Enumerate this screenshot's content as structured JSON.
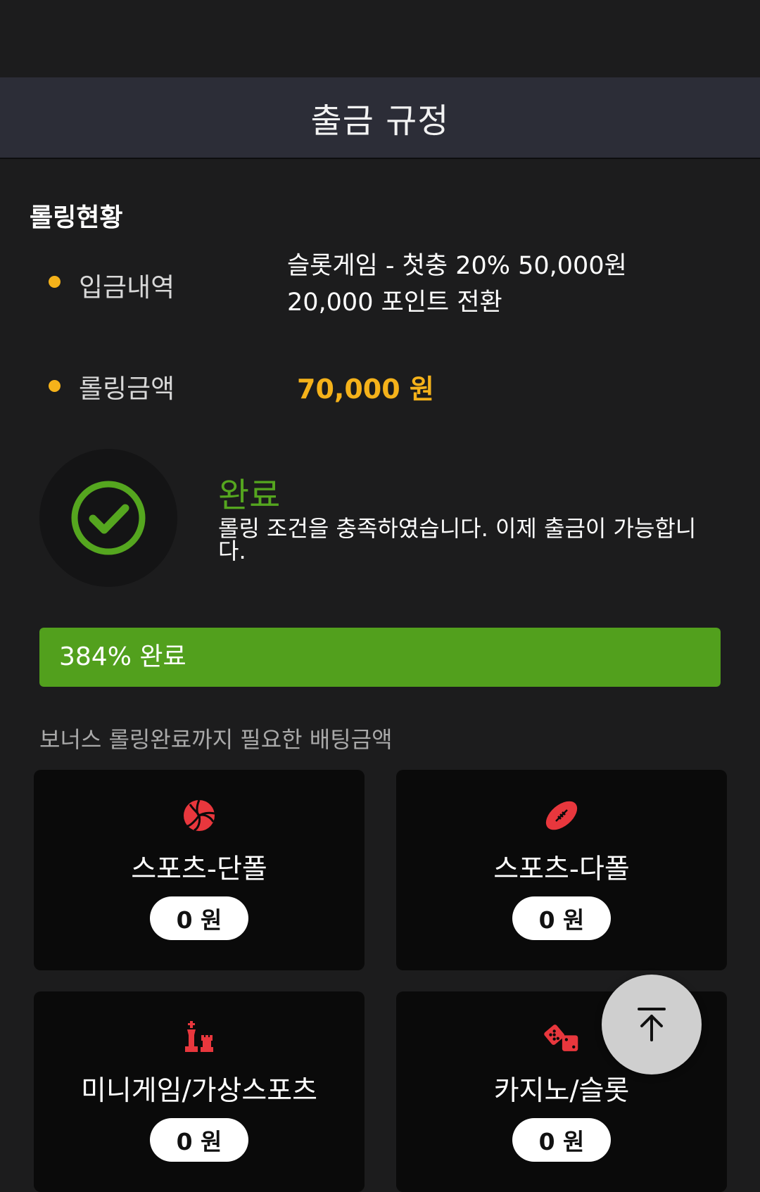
{
  "header": {
    "title": "출금 규정"
  },
  "rolling_status": {
    "section_title": "롤링현황",
    "deposit": {
      "label": "입금내역",
      "value_line1": "슬롯게임 - 첫충 20% 50,000원",
      "value_line2": "20,000 포인트 전환"
    },
    "rolling": {
      "label": "롤링금액",
      "amount": "70,000 원"
    }
  },
  "status": {
    "title": "완료",
    "description": "롤링 조건을 충족하였습니다. 이제 출금이 가능합니다."
  },
  "progress": {
    "label": "384% 완료",
    "percent": 384
  },
  "bonus": {
    "caption": "보너스 롤링완료까지 필요한 배팅금액",
    "cards": [
      {
        "label": "스포츠-단폴",
        "amount": "0 원",
        "icon": "volleyball-icon"
      },
      {
        "label": "스포츠-다폴",
        "amount": "0 원",
        "icon": "football-icon"
      },
      {
        "label": "미니게임/가상스포츠",
        "amount": "0 원",
        "icon": "chess-icon"
      },
      {
        "label": "카지노/슬롯",
        "amount": "0 원",
        "icon": "dice-icon"
      }
    ]
  },
  "colors": {
    "accent_yellow": "#f5b21a",
    "success_green": "#55a61f",
    "progress_green": "#52a01d",
    "icon_red": "#e8373d",
    "header_bg": "#2c2d37"
  },
  "scroll_top": {
    "icon": "arrow-up-to-top-icon"
  }
}
